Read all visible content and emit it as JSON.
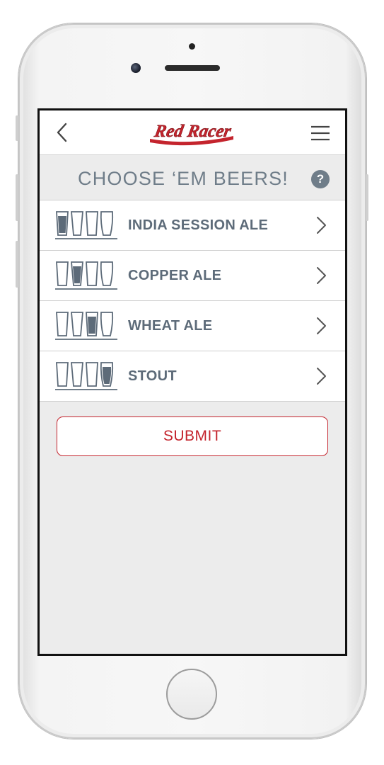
{
  "header": {
    "brand": "Red Racer",
    "back_icon": "chevron-left-icon",
    "menu_icon": "hamburger-menu-icon"
  },
  "page": {
    "title": "CHOOSE ‘EM BEERS!",
    "help_label": "?"
  },
  "beers": [
    {
      "label": "INDIA SESSION ALE",
      "highlight_index": 0
    },
    {
      "label": "COPPER ALE",
      "highlight_index": 1
    },
    {
      "label": "WHEAT ALE",
      "highlight_index": 2
    },
    {
      "label": "STOUT",
      "highlight_index": 3
    }
  ],
  "actions": {
    "submit_label": "SUBMIT"
  },
  "colors": {
    "accent": "#c4242d",
    "text": "#5d6b79",
    "title": "#6f7d89",
    "background": "#ececec"
  }
}
